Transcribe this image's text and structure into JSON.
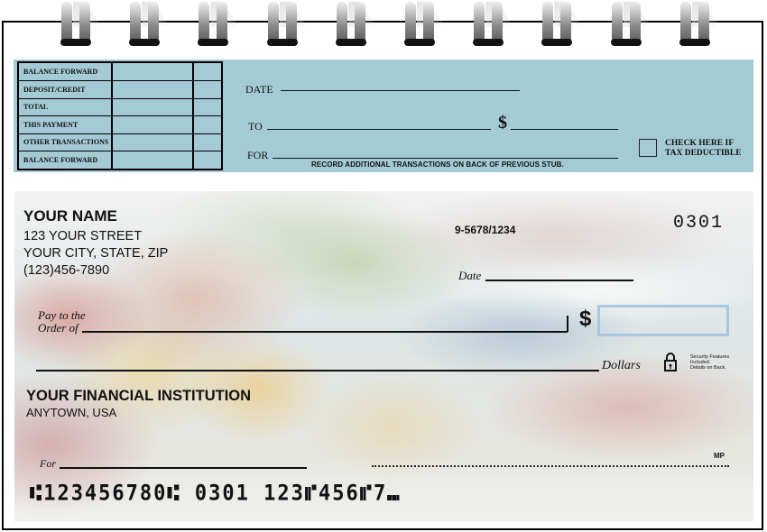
{
  "binding": {
    "ring_count": 10,
    "icon": "spiral-binding-ring-icon"
  },
  "stub": {
    "ledger_rows": [
      {
        "label": "BALANCE FORWARD"
      },
      {
        "label": "DEPOSIT/CREDIT"
      },
      {
        "label": "TOTAL"
      },
      {
        "label": "THIS PAYMENT"
      },
      {
        "label": "OTHER TRANSACTIONS"
      },
      {
        "label": "BALANCE FORWARD"
      }
    ],
    "date_label": "DATE",
    "to_label": "TO",
    "dollar_sign": "$",
    "for_label": "FOR",
    "note": "RECORD ADDITIONAL TRANSACTIONS ON BACK OF PREVIOUS STUB.",
    "tax_line1": "CHECK HERE IF",
    "tax_line2": "TAX DEDUCTIBLE",
    "background_color": "#a4cbd5"
  },
  "check": {
    "owner_name": "YOUR NAME",
    "street": "123 YOUR STREET",
    "city_state_zip": "YOUR CITY, STATE, ZIP",
    "phone": "(123)456-7890",
    "routing_fraction": "9-5678/1234",
    "check_number": "0301",
    "date_label": "Date",
    "pay_to_line1": "Pay to the",
    "pay_to_line2": "Order of",
    "dollar_sign": "$",
    "dollars_label": "Dollars",
    "security_icon": "lock-icon",
    "security_line1": "Security Features",
    "security_line2": "Included.",
    "security_line3": "Details on Back.",
    "bank_name": "YOUR FINANCIAL INSTITUTION",
    "bank_town": "ANYTOWN, USA",
    "for_label": "For",
    "mp_mark": "MP",
    "micr_line": "⑆123456780⑆ 0301 123⑈456⑈7⑉",
    "amount_box_color": "#a9c8e0"
  }
}
